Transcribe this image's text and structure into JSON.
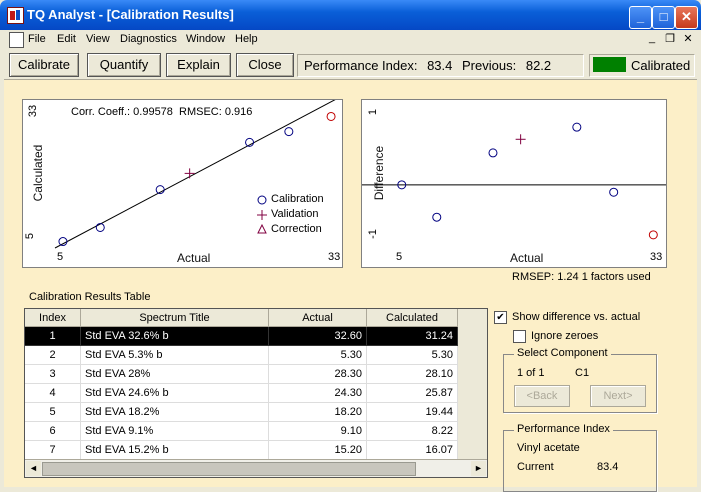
{
  "window": {
    "title": "TQ Analyst  - [Calibration Results]",
    "controls": {
      "minimize": "_",
      "maximize": "□",
      "close": "✕"
    }
  },
  "menu": [
    "File",
    "Edit",
    "View",
    "Diagnostics",
    "Window",
    "Help"
  ],
  "mdi_controls": {
    "minimize": "_",
    "restore": "❐",
    "close": "✕"
  },
  "toolbar": {
    "calibrate": "Calibrate",
    "quantify": "Quantify",
    "explain": "Explain",
    "close": "Close",
    "performance_label": "Performance Index:",
    "performance_value": "83.4",
    "previous_label": "Previous:",
    "previous_value": "82.2",
    "status": "Calibrated",
    "status_color": "#008000"
  },
  "plot1": {
    "annotation_corr": "Corr. Coeff.: 0.99578",
    "annotation_rmsec": "RMSEC: 0.916",
    "xlabel": "Actual",
    "ylabel": "Calculated",
    "xmin_tick": "5",
    "xmax_tick": "33",
    "ymin_tick": "5",
    "ymax_tick": "33",
    "legend": [
      "Calibration",
      "Validation",
      "Correction"
    ]
  },
  "plot2": {
    "xlabel": "Actual",
    "ylabel": "Difference",
    "xmin_tick": "5",
    "xmax_tick": "33",
    "ymin_tick": "-1",
    "ymax_tick": "1",
    "footer": "RMSEP:  1.24    1 factors used"
  },
  "table": {
    "caption": "Calibration Results Table",
    "headers": [
      "Index",
      "Spectrum Title",
      "Actual",
      "Calculated"
    ],
    "rows": [
      [
        "1",
        "Std EVA 32.6% b",
        "32.60",
        "31.24"
      ],
      [
        "2",
        "Std EVA 5.3% b",
        "5.30",
        "5.30"
      ],
      [
        "3",
        "Std EVA 28%",
        "28.30",
        "28.10"
      ],
      [
        "4",
        "Std EVA 24.6% b",
        "24.30",
        "25.87"
      ],
      [
        "5",
        "Std EVA 18.2%",
        "18.20",
        "19.44"
      ],
      [
        "6",
        "Std EVA 9.1%",
        "9.10",
        "8.22"
      ],
      [
        "7",
        "Std EVA 15.2% b",
        "15.20",
        "16.07"
      ]
    ],
    "selected_row": 0,
    "scroll_left": "◄",
    "scroll_right": "►"
  },
  "options": {
    "show_difference": "Show difference vs. actual",
    "show_difference_checked": true,
    "ignore_zeroes": "Ignore zeroes",
    "ignore_zeroes_checked": false,
    "check_mark": "✔"
  },
  "select_component": {
    "title": "Select Component",
    "counter": "1 of 1",
    "component": "C1",
    "back": "<Back",
    "next": "Next>"
  },
  "performance_index": {
    "title": "Performance Index",
    "component_name": "Vinyl acetate",
    "current_label": "Current",
    "current_value": "83.4"
  },
  "chart_data": [
    {
      "type": "scatter",
      "xlabel": "Actual",
      "ylabel": "Calculated",
      "xlim": [
        5,
        33
      ],
      "ylim": [
        5,
        33
      ],
      "series": [
        {
          "name": "Calibration",
          "points": [
            [
              5.3,
              5.3
            ],
            [
              9.1,
              8.22
            ],
            [
              15.2,
              16.07
            ],
            [
              24.3,
              25.87
            ],
            [
              28.3,
              28.1
            ],
            [
              18.2,
              19.44
            ],
            [
              32.6,
              31.24
            ]
          ]
        }
      ],
      "validation_points": [
        [
          18.2,
          19.44
        ]
      ],
      "correction_points": []
    },
    {
      "type": "scatter",
      "xlabel": "Actual",
      "ylabel": "Difference",
      "xlim": [
        5,
        33
      ],
      "ylim": [
        -1.5,
        2.2
      ],
      "series": [
        {
          "name": "Calibration",
          "points": [
            [
              5.3,
              0.0
            ],
            [
              9.1,
              -0.88
            ],
            [
              15.2,
              0.87
            ],
            [
              24.3,
              1.57
            ],
            [
              28.3,
              -0.2
            ],
            [
              32.6,
              -1.36
            ]
          ]
        }
      ],
      "validation_points": [
        [
          18.2,
          1.24
        ]
      ]
    }
  ]
}
